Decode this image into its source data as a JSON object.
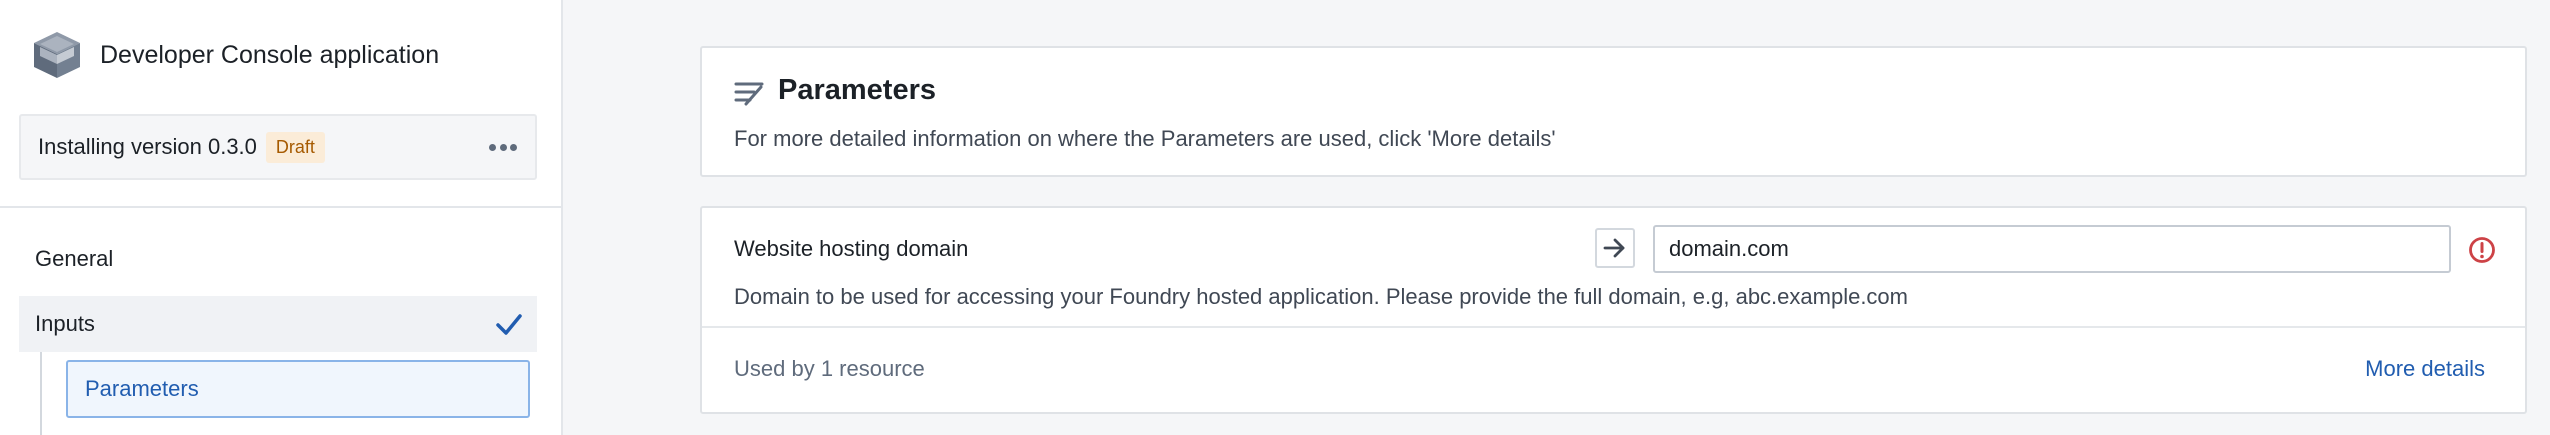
{
  "sidebar": {
    "app_title": "Developer Console application",
    "version": {
      "text": "Installing version 0.3.0",
      "badge": "Draft",
      "badge_color": "#a65a00",
      "badge_bg": "#fbecd8"
    },
    "nav": {
      "general": "General",
      "inputs": "Inputs",
      "parameters": "Parameters"
    }
  },
  "main": {
    "header": {
      "title": "Parameters",
      "description": "For more detailed information on where the Parameters are used, click 'More details'"
    },
    "parameter": {
      "label": "Website hosting domain",
      "value": "domain.com",
      "description": "Domain to be used for accessing your Foundry hosted application. Please provide the full domain, e.g, abc.example.com",
      "used_by": "Used by 1 resource",
      "more_details": "More details"
    }
  },
  "colors": {
    "accent": "#215db0",
    "error": "#cd4246",
    "check": "#215db0"
  },
  "icons": {
    "app": "app-box-icon",
    "more": "more-horizontal-icon",
    "check": "tick-icon",
    "parameters": "parameters-icon",
    "arrow": "arrow-right-icon",
    "error": "error-icon"
  }
}
